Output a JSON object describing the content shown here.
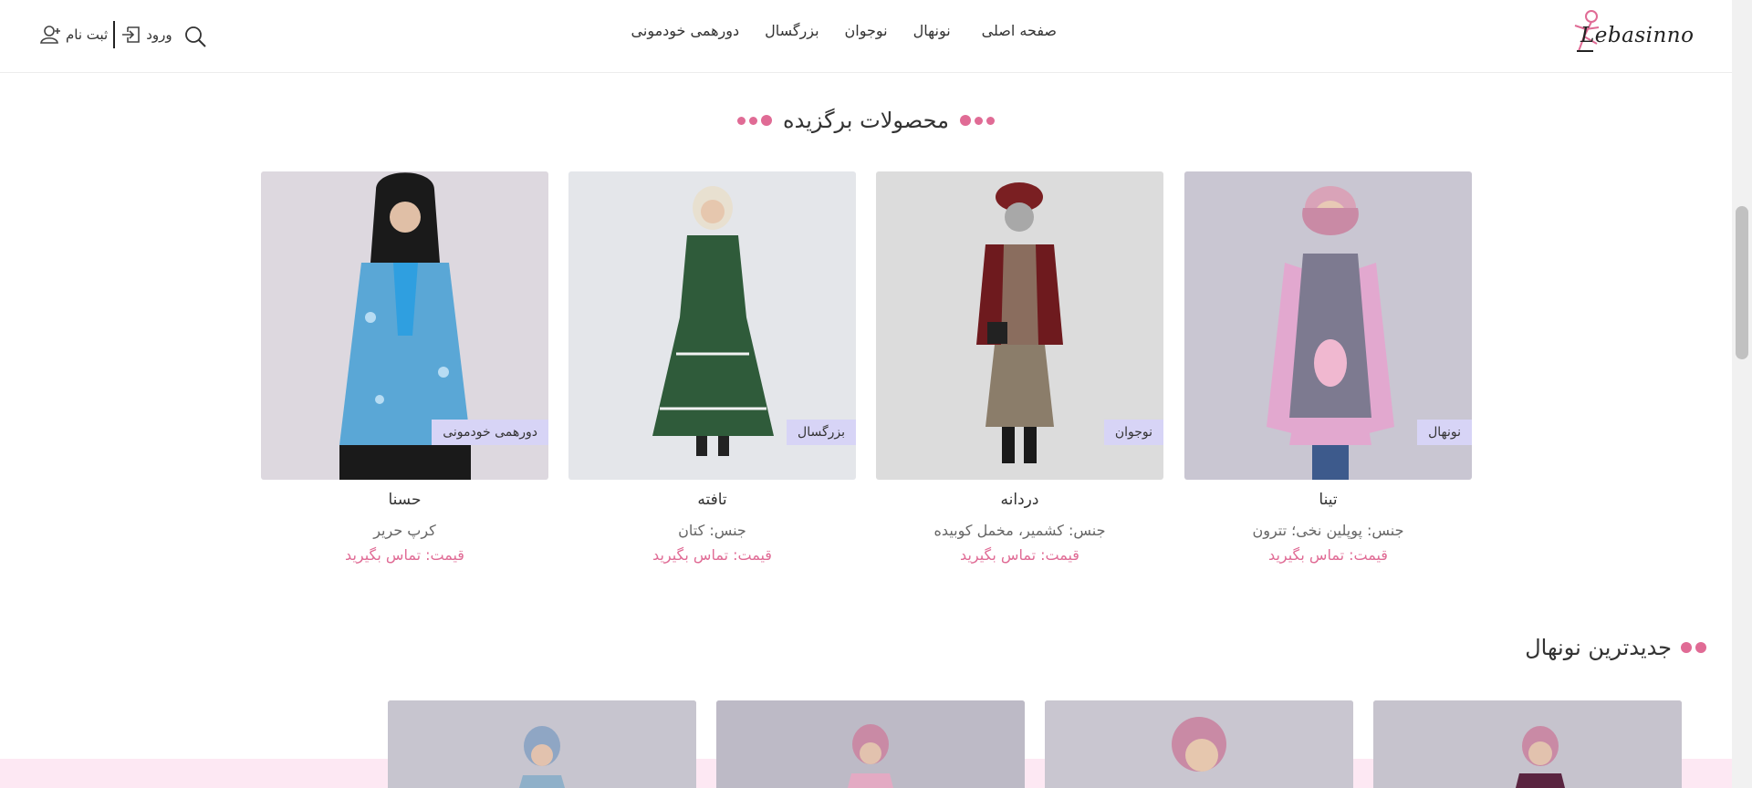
{
  "header": {
    "logo_text": "Lebasinno",
    "nav": [
      {
        "label": "صفحه اصلی"
      },
      {
        "label": "نونهال"
      },
      {
        "label": "نوجوان"
      },
      {
        "label": "بزرگسال"
      },
      {
        "label": "دورهمی خودمونی"
      }
    ],
    "login_label": "ورود",
    "register_label": "ثبت نام",
    "search_icon": "search-icon"
  },
  "featured": {
    "title": "محصولات برگزیده",
    "products": [
      {
        "name": "تینا",
        "category": "نونهال",
        "fabric": "جنس: پوپلین نخی؛ تترون",
        "price": "قیمت: تماس بگیرید"
      },
      {
        "name": "دردانه",
        "category": "نوجوان",
        "fabric": "جنس: کشمیر، مخمل کوبیده",
        "price": "قیمت: تماس بگیرید"
      },
      {
        "name": "تافته",
        "category": "بزرگسال",
        "fabric": "جنس: کتان",
        "price": "قیمت: تماس بگیرید"
      },
      {
        "name": "حسنا",
        "category": "دورهمی خودمونی",
        "fabric": "کرپ حریر",
        "price": "قیمت: تماس بگیرید"
      }
    ]
  },
  "newest": {
    "title": "جدیدترین نونهال"
  },
  "colors": {
    "accent": "#e06b95",
    "badge_bg": "#d7d4f6",
    "band": "#fde8f3"
  }
}
